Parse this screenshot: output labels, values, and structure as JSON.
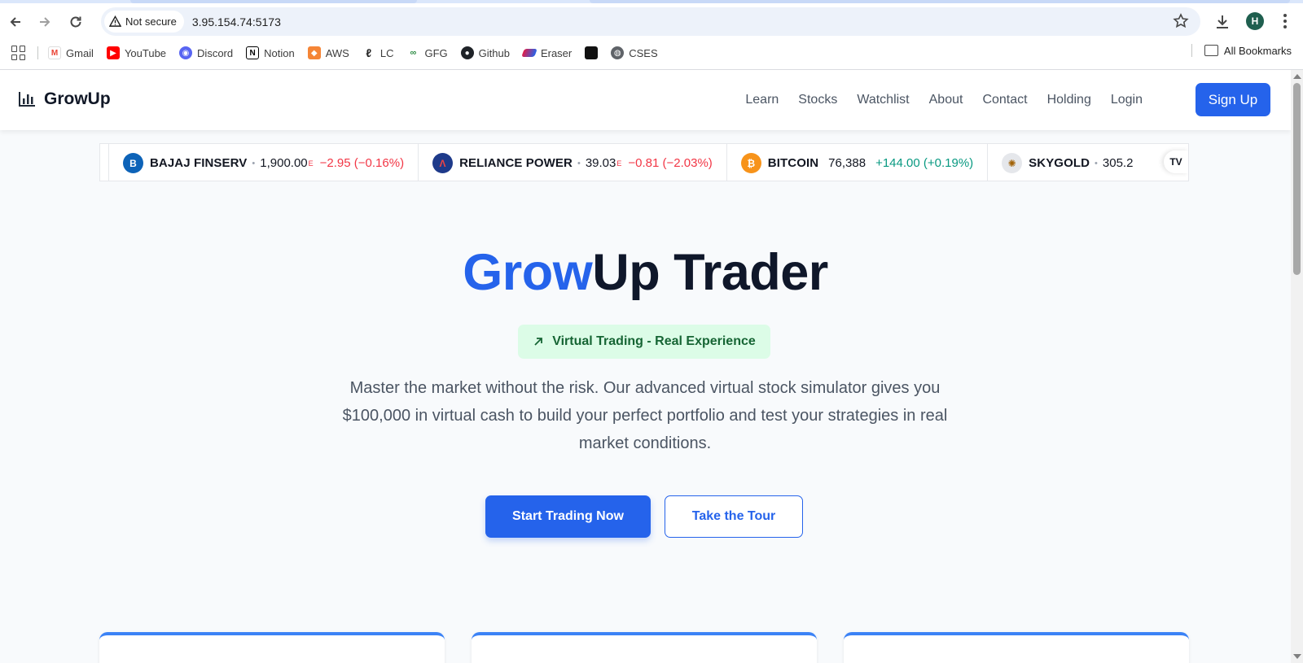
{
  "browser": {
    "security_label": "Not secure",
    "url": "3.95.154.74:5173",
    "profile_initial": "H",
    "bookmarks": [
      {
        "label": "Gmail",
        "icon": "gmail-icon"
      },
      {
        "label": "YouTube",
        "icon": "youtube-icon"
      },
      {
        "label": "Discord",
        "icon": "discord-icon"
      },
      {
        "label": "Notion",
        "icon": "notion-icon"
      },
      {
        "label": "AWS",
        "icon": "aws-icon"
      },
      {
        "label": "LC",
        "icon": "leetcode-icon"
      },
      {
        "label": "GFG",
        "icon": "gfg-icon"
      },
      {
        "label": "Github",
        "icon": "github-icon"
      },
      {
        "label": "Eraser",
        "icon": "eraser-icon"
      },
      {
        "label": "",
        "icon": "dark-square-icon"
      },
      {
        "label": "CSES",
        "icon": "globe-icon"
      }
    ],
    "all_bookmarks_label": "All Bookmarks"
  },
  "navbar": {
    "brand": "GrowUp",
    "links": [
      "Learn",
      "Stocks",
      "Watchlist",
      "About",
      "Contact",
      "Holding",
      "Login"
    ],
    "signup_label": "Sign Up"
  },
  "ticker": [
    {
      "name": "BAJAJ FINSERV",
      "price": "1,900.00",
      "flag": "E",
      "change": "−2.95 (−0.16%)",
      "direction": "down",
      "logo_color": "#0d63b8",
      "logo_text": "B"
    },
    {
      "name": "RELIANCE POWER",
      "price": "39.03",
      "flag": "E",
      "change": "−0.81 (−2.03%)",
      "direction": "down",
      "logo_color": "#1e3a8a",
      "logo_text": "Λ"
    },
    {
      "name": "BITCOIN",
      "price": "76,388",
      "flag": "",
      "change": "+144.00 (+0.19%)",
      "direction": "up",
      "logo_color": "#f7931a",
      "logo_text": "₿"
    },
    {
      "name": "SKYGOLD",
      "price": "305.2",
      "flag": "",
      "change": "",
      "direction": "down",
      "logo_color": "#e5e7eb",
      "logo_text": "✺"
    }
  ],
  "ticker_badge": "TV",
  "hero": {
    "title_accent": "Grow",
    "title_rest": "Up Trader",
    "tag": "Virtual Trading - Real Experience",
    "description": "Master the market without the risk. Our advanced virtual stock simulator gives you $100,000 in virtual cash to build your perfect portfolio and test your strategies in real market conditions.",
    "primary_cta": "Start Trading Now",
    "secondary_cta": "Take the Tour"
  },
  "colors": {
    "accent": "#2563eb",
    "tag_bg": "#dcfce7",
    "tag_text": "#166534",
    "negative": "#f23645",
    "positive": "#089981"
  }
}
